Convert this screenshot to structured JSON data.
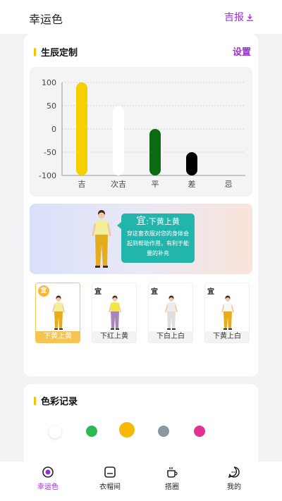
{
  "header": {
    "title": "幸运色",
    "report_label": "吉报"
  },
  "birth_section": {
    "title": "生辰定制",
    "settings_label": "设置"
  },
  "chart_data": {
    "type": "bar",
    "categories": [
      "吉",
      "次吉",
      "平",
      "差",
      "忌"
    ],
    "values": [
      100,
      50,
      0,
      -50,
      -100
    ],
    "colors": [
      "#f5d000",
      "#ffffff",
      "#0b6b12",
      "#000000",
      "#ffffff"
    ],
    "y_ticks": [
      100,
      50,
      0,
      -50,
      -100
    ],
    "ylim": [
      -100,
      100
    ],
    "grid": true
  },
  "banner": {
    "prefix": "宜",
    "title": ":下黄上黄",
    "description": "穿这套衣服对您的身体会起到帮助作用，有利于能量的补充"
  },
  "outfits": [
    {
      "tag": "宜",
      "label": "下黄上黄",
      "top": "#f6ef9a",
      "bottom": "#e5ad1b",
      "selected": true
    },
    {
      "tag": "宜",
      "label": "下红上黄",
      "top": "#f1ea3c",
      "bottom": "#a985b8",
      "selected": false
    },
    {
      "tag": "宜",
      "label": "下白上白",
      "top": "#ececec",
      "bottom": "#dedede",
      "selected": false
    },
    {
      "tag": "宜",
      "label": "下黄上白",
      "top": "#f7f7f7",
      "bottom": "#e5ad1b",
      "selected": false
    }
  ],
  "color_section": {
    "title": "色彩记录",
    "colors": [
      "#ffffff",
      "#2fb955",
      "#f6b908",
      "#8a98a4",
      "#e1338c"
    ]
  },
  "nav": [
    {
      "label": "幸运色",
      "icon": "lucky-color-icon",
      "active": true
    },
    {
      "label": "衣帽间",
      "icon": "wardrobe-icon",
      "active": false
    },
    {
      "label": "搭圈",
      "icon": "coffee-cup-icon",
      "active": false
    },
    {
      "label": "我的",
      "icon": "profile-chat-icon",
      "active": false
    }
  ]
}
